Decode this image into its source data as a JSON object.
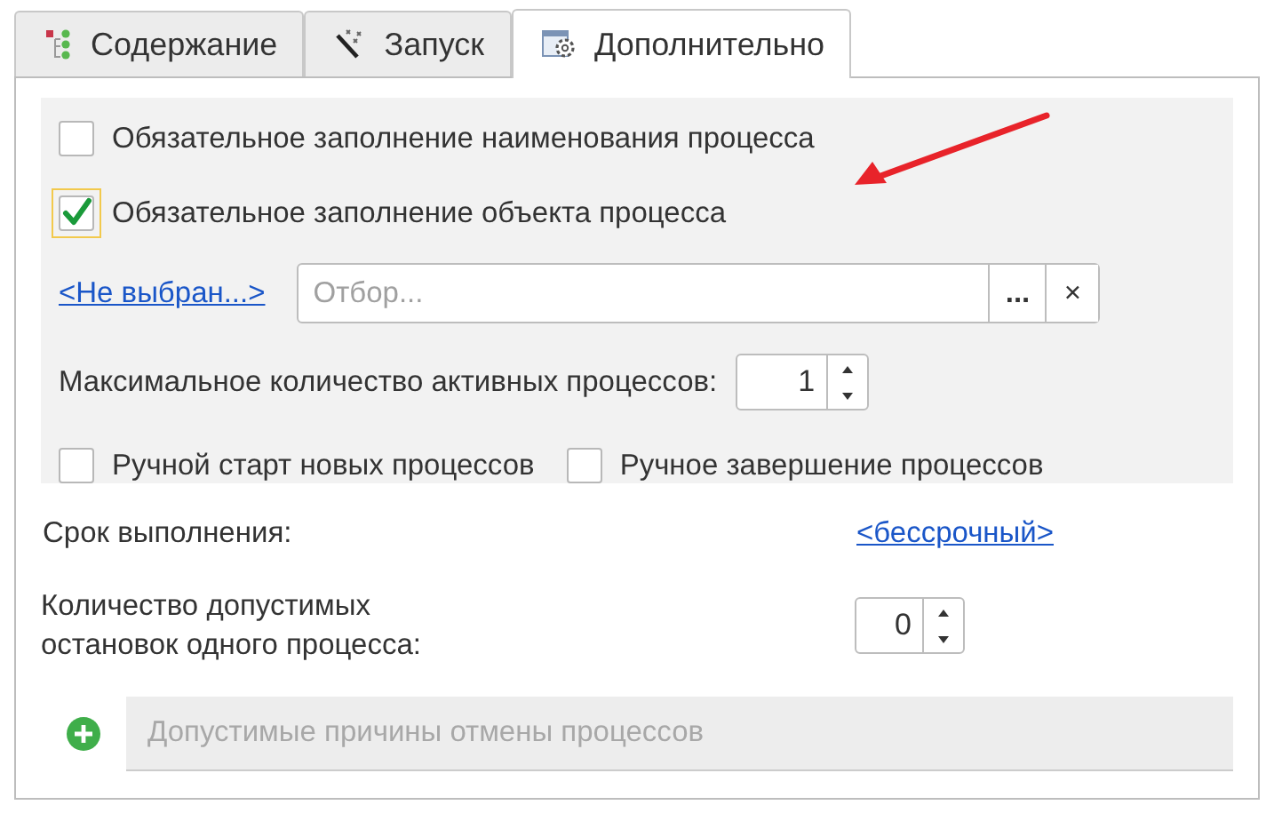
{
  "tabs": [
    {
      "label": "Содержание",
      "kind": "tree",
      "selected": false
    },
    {
      "label": "Запуск",
      "kind": "wand",
      "selected": false
    },
    {
      "label": "Дополнительно",
      "kind": "settings",
      "selected": true
    }
  ],
  "group": {
    "options": [
      {
        "label": "Обязательное заполнение наименования процесса",
        "checked": false,
        "focused": false
      },
      {
        "label": "Обязательное заполнение объекта процесса",
        "checked": true,
        "focused": true
      }
    ],
    "filter": {
      "link": "<Не выбран...>",
      "placeholder": "Отбор...",
      "select_button": "...",
      "clear_button": "×"
    },
    "max_active": {
      "label": "Максимальное количество активных процессов:",
      "value": "1"
    },
    "manual": [
      {
        "label": "Ручной старт новых процессов",
        "checked": false
      },
      {
        "label": "Ручное завершение процессов",
        "checked": false
      }
    ]
  },
  "deadline": {
    "label": "Срок выполнения:",
    "link": "<бессрочный>"
  },
  "stops": {
    "label": "Количество допустимых остановок одного процесса:",
    "value": "0"
  },
  "reasons": {
    "placeholder": "Допустимые причины отмены процессов"
  }
}
